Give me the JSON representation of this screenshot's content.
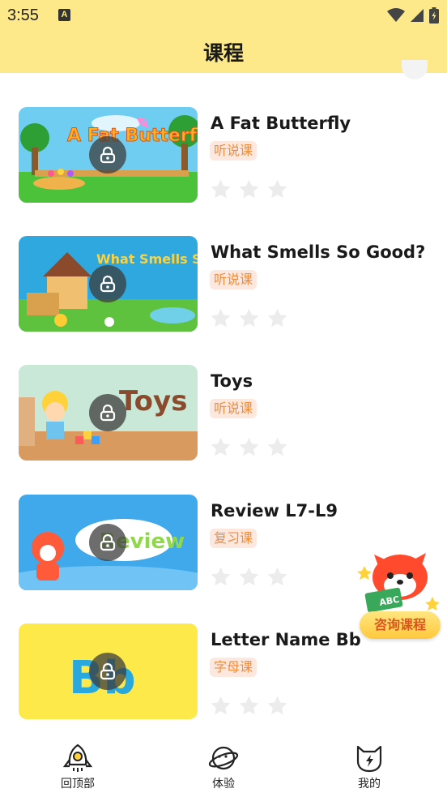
{
  "status_bar": {
    "time": "3:55",
    "notification": "A"
  },
  "header": {
    "title": "课程"
  },
  "courses": [
    {
      "title": "A Fat Butterfly",
      "tag": "听说课",
      "thumb_text": "A Fat Butterfly",
      "stars": 0
    },
    {
      "title": "What Smells So Good?",
      "tag": "听说课",
      "thumb_text": "What Smells So Good?",
      "stars": 0
    },
    {
      "title": "Toys",
      "tag": "听说课",
      "thumb_text": "Toys",
      "stars": 0
    },
    {
      "title": "Review L7-L9",
      "tag": "复习课",
      "thumb_text": "Review",
      "stars": 0
    },
    {
      "title": "Letter Name Bb",
      "tag": "字母课",
      "thumb_text": "Bb",
      "stars": 0
    }
  ],
  "consult": {
    "label": "咨询课程",
    "book_text": "ABC"
  },
  "bottom_nav": [
    {
      "label": "回顶部",
      "icon": "rocket-icon"
    },
    {
      "label": "体验",
      "icon": "planet-icon"
    },
    {
      "label": "我的",
      "icon": "cat-face-icon"
    }
  ],
  "colors": {
    "header_bg": "#fde98a",
    "tag_bg": "#fde8df",
    "tag_text": "#f08c3a",
    "star": "#ececec"
  }
}
